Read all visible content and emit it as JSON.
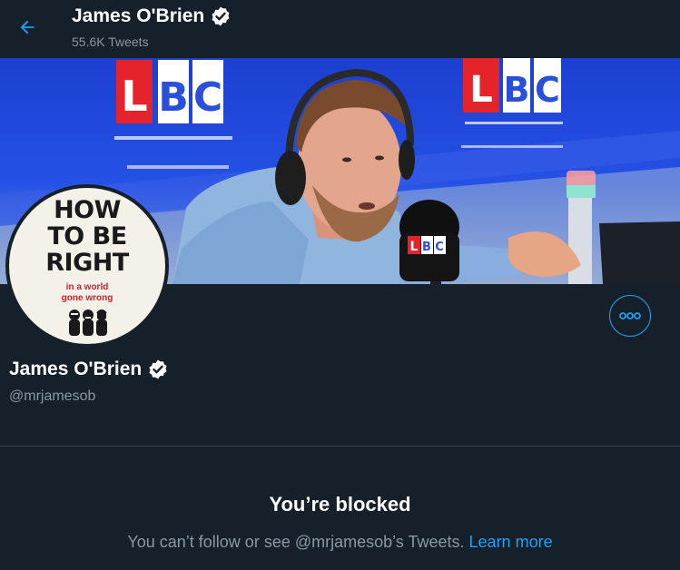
{
  "header": {
    "name": "James O'Brien",
    "tweet_count": "55.6K Tweets"
  },
  "banner": {
    "logo_text": "LBC",
    "mic_label": "LBC"
  },
  "avatar": {
    "line1": "HOW",
    "line2": "TO BE",
    "line3": "RIGHT",
    "subtitle1": "in a world",
    "subtitle2": "gone wrong"
  },
  "profile": {
    "name": "James O'Brien",
    "handle": "@mrjamesob"
  },
  "blocked": {
    "title": "You’re blocked",
    "message": "You can’t follow or see @mrjamesob’s Tweets.",
    "link": "Learn more"
  },
  "colors": {
    "background": "#15202b",
    "accent": "#1da1f2",
    "secondary_text": "#8899a6"
  },
  "icons": {
    "back": "arrow-left-icon",
    "verified": "verified-badge-icon",
    "more": "more-horizontal-icon"
  }
}
